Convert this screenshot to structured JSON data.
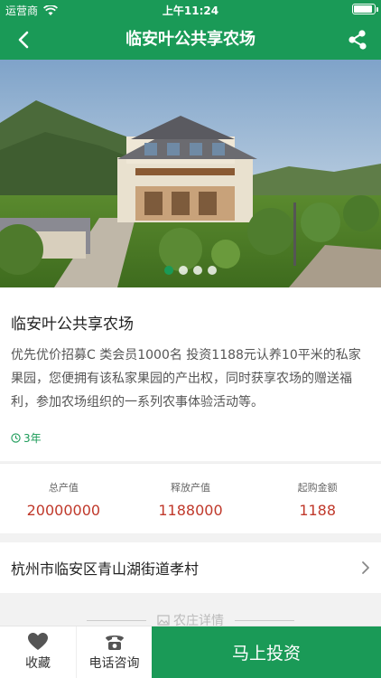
{
  "status_bar": {
    "carrier": "运营商",
    "time": "上午11:24",
    "battery_level": 0.9
  },
  "nav": {
    "title": "临安叶公共享农场",
    "back_icon": "chevron-left-icon",
    "share_icon": "share-icon"
  },
  "carousel": {
    "slide_count": 4,
    "active_index": 0
  },
  "farm": {
    "title": "临安叶公共享农场",
    "description": "优先优价招募C 类会员1000名 投资1188元认养10平米的私家果园，您便拥有该私家果园的产出权，同时获享农场的赠送福利，参加农场组织的一系列农事体验活动等。",
    "duration": "3年"
  },
  "stats": [
    {
      "label": "总产值",
      "value": "20000000"
    },
    {
      "label": "释放产值",
      "value": "1188000"
    },
    {
      "label": "起购金额",
      "value": "1188"
    }
  ],
  "address": {
    "text": "杭州市临安区青山湖街道孝村"
  },
  "details_section": {
    "label": "农庄详情"
  },
  "bottom_bar": {
    "favorite_label": "收藏",
    "phone_label": "电话咨询",
    "invest_label": "马上投资"
  },
  "colors": {
    "brand": "#1a9a57",
    "value_red": "#c0392b"
  }
}
